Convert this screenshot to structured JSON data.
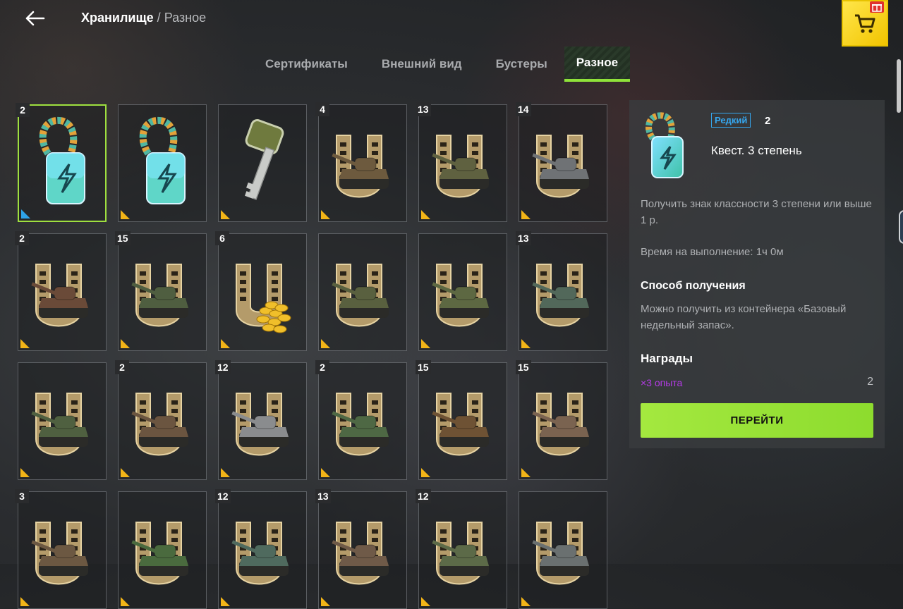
{
  "header": {
    "root": "Хранилище",
    "separator": "/",
    "current": "Разное"
  },
  "tabs": [
    "Сертификаты",
    "Внешний вид",
    "Бустеры",
    "Разное"
  ],
  "active_tab": 3,
  "colors": {
    "accent": "#8fe23a",
    "rare": "#35a7ef",
    "reward": "#b43be6",
    "common_corner": "#f2b417"
  },
  "items": [
    {
      "count": "2",
      "kind": "badge",
      "tank": "",
      "rarity": "rare",
      "selected": true
    },
    {
      "count": "",
      "kind": "badge",
      "tank": "",
      "rarity": "common"
    },
    {
      "count": "",
      "kind": "key",
      "tank": "",
      "rarity": "common"
    },
    {
      "count": "4",
      "kind": "shoe",
      "tank": "#6d5a3e",
      "rarity": "common"
    },
    {
      "count": "13",
      "kind": "shoe",
      "tank": "#5f6140",
      "rarity": "common"
    },
    {
      "count": "14",
      "kind": "shoe",
      "tank": "#6f7275",
      "rarity": "common"
    },
    {
      "count": "2",
      "kind": "shoe",
      "tank": "#6a4a38",
      "rarity": "common"
    },
    {
      "count": "15",
      "kind": "shoe",
      "tank": "#4f5e40",
      "rarity": "common"
    },
    {
      "count": "6",
      "kind": "coins",
      "tank": "",
      "rarity": "common"
    },
    {
      "count": "",
      "kind": "shoe",
      "tank": "#59603f",
      "rarity": "common"
    },
    {
      "count": "",
      "kind": "shoe",
      "tank": "#5d6842",
      "rarity": "common"
    },
    {
      "count": "13",
      "kind": "shoe",
      "tank": "#52685a",
      "rarity": "common"
    },
    {
      "count": "",
      "kind": "shoe",
      "tank": "#4f6040",
      "rarity": "common"
    },
    {
      "count": "2",
      "kind": "shoe",
      "tank": "#6b5540",
      "rarity": "common"
    },
    {
      "count": "12",
      "kind": "shoe",
      "tank": "#8a8c8e",
      "rarity": "common"
    },
    {
      "count": "2",
      "kind": "shoe",
      "tank": "#4e6844",
      "rarity": "common"
    },
    {
      "count": "15",
      "kind": "shoe",
      "tank": "#6e5234",
      "rarity": "common"
    },
    {
      "count": "15",
      "kind": "shoe",
      "tank": "#7a6350",
      "rarity": "common"
    },
    {
      "count": "3",
      "kind": "shoe",
      "tank": "#6c5842",
      "rarity": "common"
    },
    {
      "count": "",
      "kind": "shoe",
      "tank": "#4a6a3e",
      "rarity": "common"
    },
    {
      "count": "12",
      "kind": "shoe",
      "tank": "#4f6a5e",
      "rarity": "common"
    },
    {
      "count": "13",
      "kind": "shoe",
      "tank": "#6f5a48",
      "rarity": "common"
    },
    {
      "count": "12",
      "kind": "shoe",
      "tank": "#5c6a48",
      "rarity": "common"
    },
    {
      "count": "",
      "kind": "shoe",
      "tank": "#6a7070",
      "rarity": "common"
    }
  ],
  "detail": {
    "rarity": "Редкий",
    "count": "2",
    "title": "Квест. 3 степень",
    "description": "Получить знак классности 3 степени или выше 1 р.",
    "time": "Время на выполнение: 1ч 0м",
    "source_heading": "Способ получения",
    "source_text": "Можно получить из контейнера «Базовый недельный запас».",
    "rewards_heading": "Награды",
    "reward_label": "×3 опыта",
    "reward_count": "2",
    "go_button": "ПЕРЕЙТИ"
  }
}
